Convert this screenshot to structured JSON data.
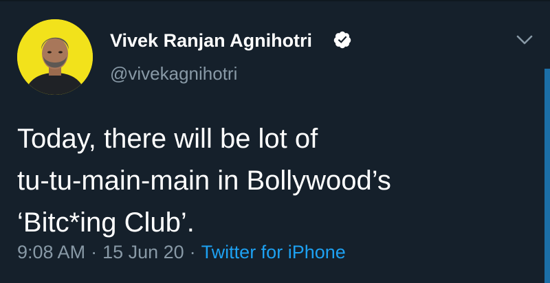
{
  "tweet": {
    "author": {
      "display_name": "Vivek Ranjan Agnihotri",
      "handle": "@vivekagnihotri",
      "verified_icon": "verified-badge-icon",
      "avatar_bg": "#f2e21b"
    },
    "text_lines": [
      "Today, there will be lot of",
      "tu-tu-main-main in Bollywood’s",
      "‘Bitc*ing Club’."
    ],
    "meta": {
      "time": "9:08 AM",
      "separator": "·",
      "date": "15 Jun 20",
      "source": "Twitter for iPhone"
    },
    "menu_icon": "chevron-down-icon"
  },
  "colors": {
    "background": "#15202b",
    "text_primary": "#ffffff",
    "text_secondary": "#8899a6",
    "accent": "#1da1f2"
  }
}
